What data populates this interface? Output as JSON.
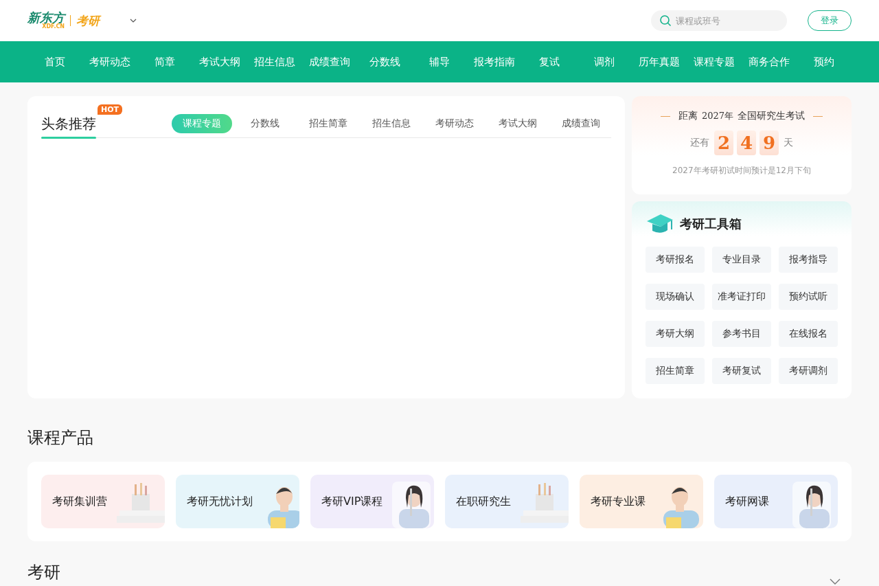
{
  "header": {
    "logo": {
      "brand": "新东方",
      "domain": "XDF.CN",
      "product": "考研"
    },
    "search": {
      "placeholder": "课程或班号"
    },
    "login": "登录"
  },
  "nav": [
    {
      "label": "首页"
    },
    {
      "label": "考研动态"
    },
    {
      "label": "简章"
    },
    {
      "label": "考试大纲"
    },
    {
      "label": "招生信息"
    },
    {
      "label": "成绩查询"
    },
    {
      "label": "分数线"
    },
    {
      "label": "辅导"
    },
    {
      "label": "报考指南"
    },
    {
      "label": "复试"
    },
    {
      "label": "调剂"
    },
    {
      "label": "历年真题"
    },
    {
      "label": "课程专题"
    },
    {
      "label": "商务合作"
    },
    {
      "label": "预约"
    }
  ],
  "headlines": {
    "title": "头条推荐",
    "badge": "HOT",
    "tabs": [
      {
        "label": "课程专题",
        "selected": true
      },
      {
        "label": "分数线",
        "selected": false
      },
      {
        "label": "招生简章",
        "selected": false
      },
      {
        "label": "招生信息",
        "selected": false
      },
      {
        "label": "考研动态",
        "selected": false
      },
      {
        "label": "考试大纲",
        "selected": false
      },
      {
        "label": "成绩查询",
        "selected": false
      }
    ]
  },
  "countdown": {
    "prefix": "距离",
    "year": "2027年",
    "exam": "全国研究生考试",
    "left": "还有",
    "digits": [
      "2",
      "4",
      "9"
    ],
    "unit": "天",
    "note": "2027年考研初试时间预计是12月下旬"
  },
  "toolbox": {
    "title": "考研工具箱",
    "items": [
      "考研报名",
      "专业目录",
      "报考指导",
      "现场确认",
      "准考证打印",
      "预约试听",
      "考研大纲",
      "参考书目",
      "在线报名",
      "招生简章",
      "考研复试",
      "考研调剂"
    ]
  },
  "products": {
    "title": "课程产品",
    "items": [
      {
        "label": "考研集训营",
        "color": "#fdeeee"
      },
      {
        "label": "考研无忧计划",
        "color": "#e6f5fa"
      },
      {
        "label": "考研VIP课程",
        "color": "#f1edfb"
      },
      {
        "label": "在职研究生",
        "color": "#e9f1fc"
      },
      {
        "label": "考研专业课",
        "color": "#fdeee2"
      },
      {
        "label": "考研网课",
        "color": "#e9effb"
      }
    ]
  },
  "next_section": {
    "title": "考研"
  }
}
